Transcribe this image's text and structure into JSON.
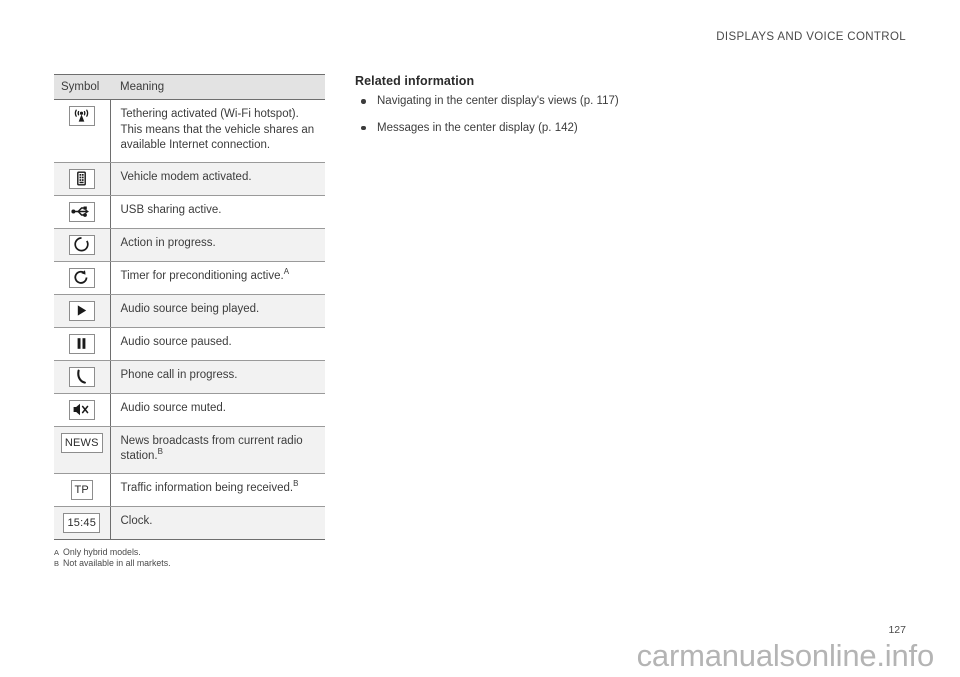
{
  "header": {
    "running_head": "DISPLAYS AND VOICE CONTROL"
  },
  "table": {
    "columns": {
      "symbol": "Symbol",
      "meaning": "Meaning"
    },
    "rows": [
      {
        "icon": "wifi-tethering-icon",
        "icon_label": "",
        "meaning": "Tethering activated (Wi-Fi hotspot). This means that the vehicle shares an available Internet connection.",
        "footnote": ""
      },
      {
        "icon": "vehicle-modem-icon",
        "icon_label": "",
        "meaning": "Vehicle modem activated.",
        "footnote": ""
      },
      {
        "icon": "usb-icon",
        "icon_label": "",
        "meaning": "USB sharing active.",
        "footnote": ""
      },
      {
        "icon": "spinner-icon",
        "icon_label": "",
        "meaning": "Action in progress.",
        "footnote": ""
      },
      {
        "icon": "timer-icon",
        "icon_label": "",
        "meaning": "Timer for preconditioning active.",
        "footnote": "A"
      },
      {
        "icon": "play-icon",
        "icon_label": "",
        "meaning": "Audio source being played.",
        "footnote": ""
      },
      {
        "icon": "pause-icon",
        "icon_label": "",
        "meaning": "Audio source paused.",
        "footnote": ""
      },
      {
        "icon": "phone-icon",
        "icon_label": "",
        "meaning": "Phone call in progress.",
        "footnote": ""
      },
      {
        "icon": "mute-icon",
        "icon_label": "",
        "meaning": "Audio source muted.",
        "footnote": ""
      },
      {
        "icon": "news-text-icon",
        "icon_label": "NEWS",
        "meaning": "News broadcasts from current radio station.",
        "footnote": "B"
      },
      {
        "icon": "tp-text-icon",
        "icon_label": "TP",
        "meaning": "Traffic information being received.",
        "footnote": "B"
      },
      {
        "icon": "clock-text-icon",
        "icon_label": "15:45",
        "meaning": "Clock.",
        "footnote": ""
      }
    ]
  },
  "footnotes": [
    {
      "mark": "A",
      "text": "Only hybrid models."
    },
    {
      "mark": "B",
      "text": "Not available in all markets."
    }
  ],
  "related": {
    "title": "Related information",
    "items": [
      "Navigating in the center display's views (p. 117)",
      "Messages in the center display (p. 142)"
    ]
  },
  "footer": {
    "page_number": "127",
    "watermark": "carmanualsonline.info"
  },
  "colors": {
    "text": "#3c3c3c",
    "rule": "#6e6e6e",
    "header_fill": "#e3e3e3",
    "row_shade": "#f2f2f2",
    "watermark": "#b4b4b4"
  }
}
